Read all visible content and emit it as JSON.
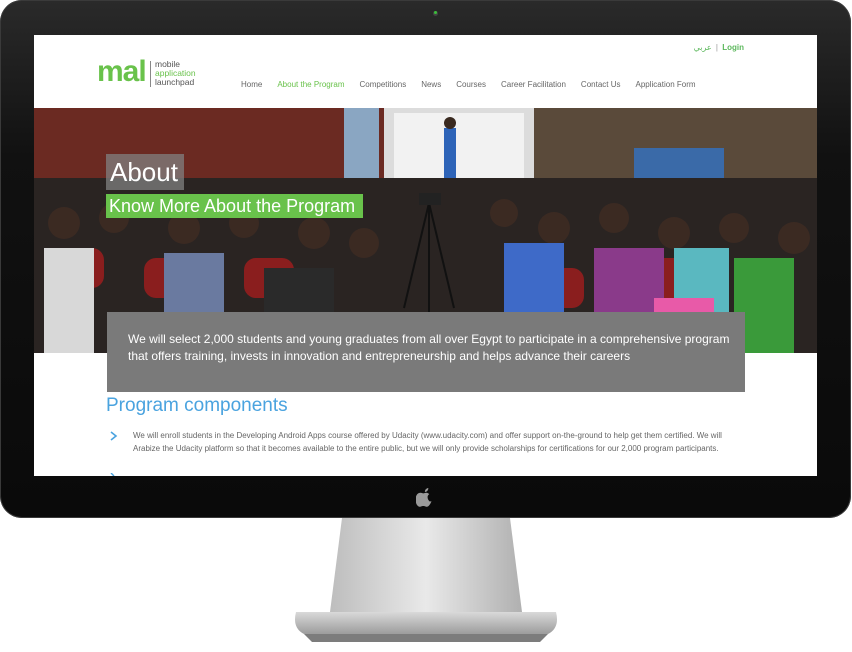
{
  "topbar": {
    "arabic_label": "عربي",
    "separator": "|",
    "login_label": "Login"
  },
  "logo": {
    "wordmark": "mal",
    "line1": "mobile",
    "line2": "application",
    "line3": "launchpad"
  },
  "nav": {
    "items": [
      {
        "label": "Home",
        "active": false
      },
      {
        "label": "About the Program",
        "active": true
      },
      {
        "label": "Competitions",
        "active": false
      },
      {
        "label": "News",
        "active": false
      },
      {
        "label": "Courses",
        "active": false
      },
      {
        "label": "Career Facilitation",
        "active": false
      },
      {
        "label": "Contact Us",
        "active": false
      },
      {
        "label": "Application Form",
        "active": false
      }
    ]
  },
  "hero": {
    "title": "About",
    "subtitle": "Know More About the Program",
    "intro": "We will select 2,000 students and young graduates from all over Egypt to participate in a comprehensive program that offers training, invests in innovation and entrepreneurship and helps advance their careers"
  },
  "program": {
    "title": "Program components",
    "items": [
      "We will enroll students in the Developing Android Apps course offered by Udacity (www.udacity.com) and offer support on-the-ground to help get them certified. We will Arabize the Udacity platform so that it becomes available to the entire public, but we will only provide scholarships for certifications for our 2,000 program participants."
    ]
  },
  "colors": {
    "accent_green": "#69c24b",
    "link_blue": "#4aa3df",
    "overlay_gray": "#7a7a7a"
  },
  "icons": {
    "device_logo": "apple-icon",
    "list_bullet": "chevron-right-icon"
  }
}
